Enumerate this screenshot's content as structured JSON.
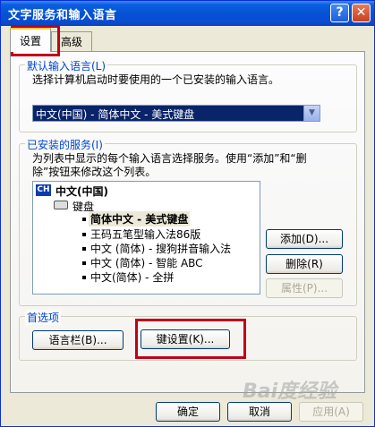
{
  "window": {
    "title": "文字服务和输入语言",
    "help_glyph": "?",
    "close_glyph": "✕"
  },
  "tabs": [
    {
      "label": "设置",
      "active": true
    },
    {
      "label": "高级",
      "active": false
    }
  ],
  "default_language": {
    "legend": "默认输入语言(L)",
    "description": "选择计算机启动时要使用的一个已安装的输入语言。",
    "selected": "中文(中国) - 简体中文 - 美式键盘"
  },
  "installed_services": {
    "legend": "已安装的服务(I)",
    "description_line1": "为列表中显示的每个输入语言选择服务。使用“添加”和“删",
    "description_line2": "除”按钮来修改这个列表。",
    "language_badge": "CH",
    "language": "中文(中国)",
    "category": "键盘",
    "items": [
      "简体中文 - 美式键盘",
      "王码五笔型输入法86版",
      "中文 (简体) - 搜狗拼音输入法",
      "中文 (简体) - 智能 ABC",
      "中文(简体) - 全拼"
    ],
    "add_label": "添加(D)...",
    "remove_label": "删除(R)",
    "properties_label": "属性(P)..."
  },
  "preferences": {
    "legend": "首选项",
    "language_bar_label": "语言栏(B)...",
    "key_settings_label": "键设置(K)..."
  },
  "footer": {
    "ok_label": "确定",
    "cancel_label": "取消",
    "apply_label": "应用(A)"
  },
  "watermark": "Bai度经验",
  "colors": {
    "titlebar": "#0553d4",
    "highlight_box": "#c0001a",
    "group_legend": "#0046d5",
    "selection": "#0a246a"
  }
}
